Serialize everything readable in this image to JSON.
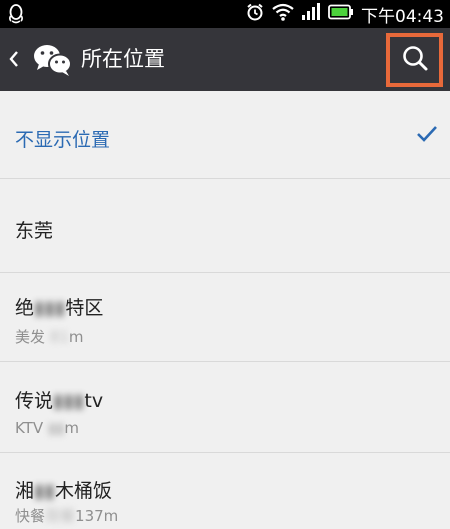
{
  "status_bar": {
    "time": "下午04:43",
    "icons": [
      "qq-icon",
      "alarm-icon",
      "wifi-icon",
      "signal-icon",
      "battery-icon"
    ]
  },
  "app_bar": {
    "title": "所在位置",
    "icons": [
      "back-icon",
      "wechat-icon",
      "search-icon"
    ]
  },
  "locations": [
    {
      "name": "不显示位置",
      "selected": true
    },
    {
      "name": "东莞",
      "selected": false
    },
    {
      "name_prefix": "绝",
      "name_blurred": "▮▮▮",
      "name_suffix": "特区",
      "sub_prefix": "美发",
      "sub_blurred": "81",
      "sub_suffix": "m"
    },
    {
      "name_prefix": "传说",
      "name_blurred": "▮▮▮",
      "name_suffix": "tv",
      "sub_prefix": "KTV",
      "sub_blurred": "▮▮",
      "sub_suffix": "m"
    },
    {
      "name_prefix": "湘",
      "name_blurred": "▮▮",
      "name_suffix": "木桶饭",
      "sub_prefix": "快餐",
      "sub_blurred": "简餐",
      "sub_suffix": "137m"
    }
  ],
  "colors": {
    "app_bar": "#35353a",
    "selected_text": "#2b6ab3",
    "annotation": "#e8693a",
    "background": "#f0f0f0"
  }
}
